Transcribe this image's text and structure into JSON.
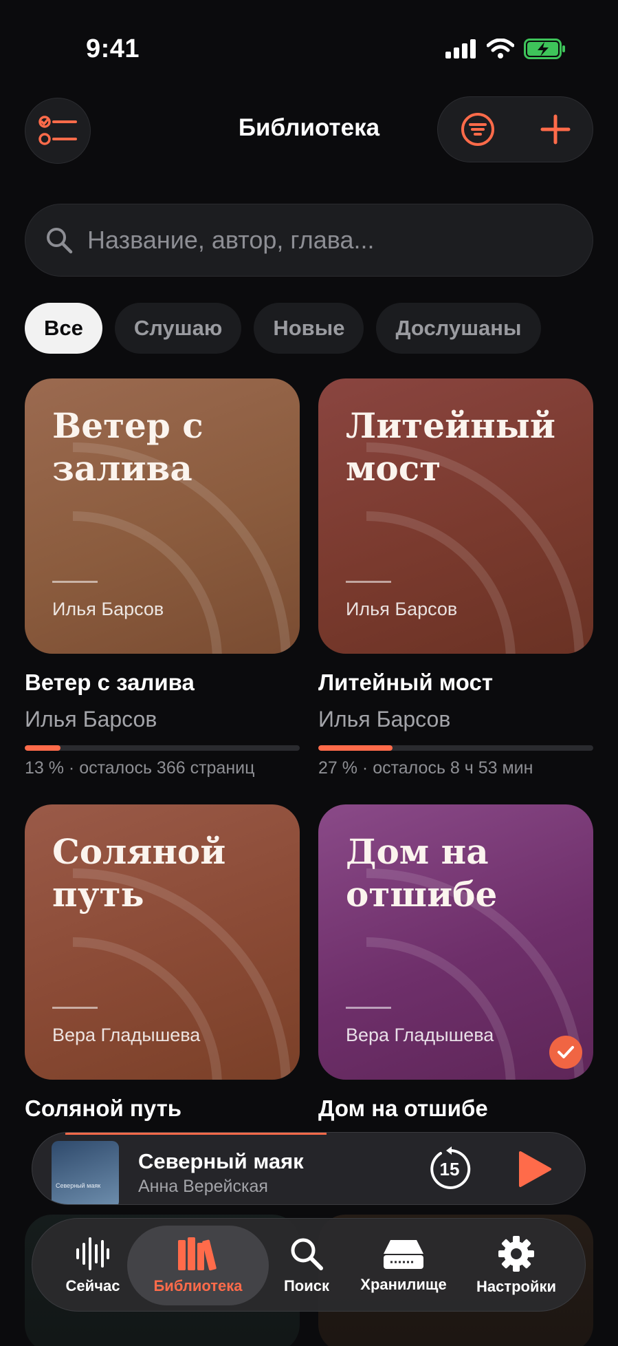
{
  "status_bar": {
    "time": "9:41"
  },
  "header": {
    "title": "Библиотека"
  },
  "search": {
    "placeholder": "Название, автор, глава..."
  },
  "filters": [
    "Все",
    "Слушаю",
    "Новые",
    "Дослушаны"
  ],
  "books": [
    {
      "cover_title": "Ветер с залива",
      "title": "Ветер с залива",
      "author": "Илья Барсов",
      "progress": 0.13,
      "progress_text": "13 % · осталось 366 страниц",
      "color": "#8a5a3e"
    },
    {
      "cover_title": "Литейный мост",
      "title": "Литейный мост",
      "author": "Илья Барсов",
      "progress": 0.27,
      "progress_text": "27 % · осталось 8 ч 53 мин",
      "color": "#7a3a2e"
    },
    {
      "cover_title": "Соляной путь",
      "title": "Соляной путь",
      "author": "Вера Гладышева",
      "cover_author": "Вера Гладышева",
      "color": "#8a4a35"
    },
    {
      "cover_title": "Дом на отшибе",
      "title": "Дом на отшибе",
      "author": "Вера Гладышева",
      "cover_author": "Вера Гладышева",
      "finished": true,
      "color": "#6e2f6a"
    }
  ],
  "mini_player": {
    "title": "Северный маяк",
    "author": "Анна Верейская",
    "art_label": "Северный маяк",
    "skip_seconds": "15"
  },
  "tabs": [
    {
      "label": "Сейчас",
      "icon": "waveform-icon"
    },
    {
      "label": "Библиотека",
      "icon": "books-icon",
      "active": true
    },
    {
      "label": "Поиск",
      "icon": "search-icon"
    },
    {
      "label": "Хранилище",
      "icon": "storage-icon"
    },
    {
      "label": "Настройки",
      "icon": "gear-icon"
    }
  ],
  "colors": {
    "accent": "#ff6b4a",
    "background": "#0b0b0d"
  }
}
